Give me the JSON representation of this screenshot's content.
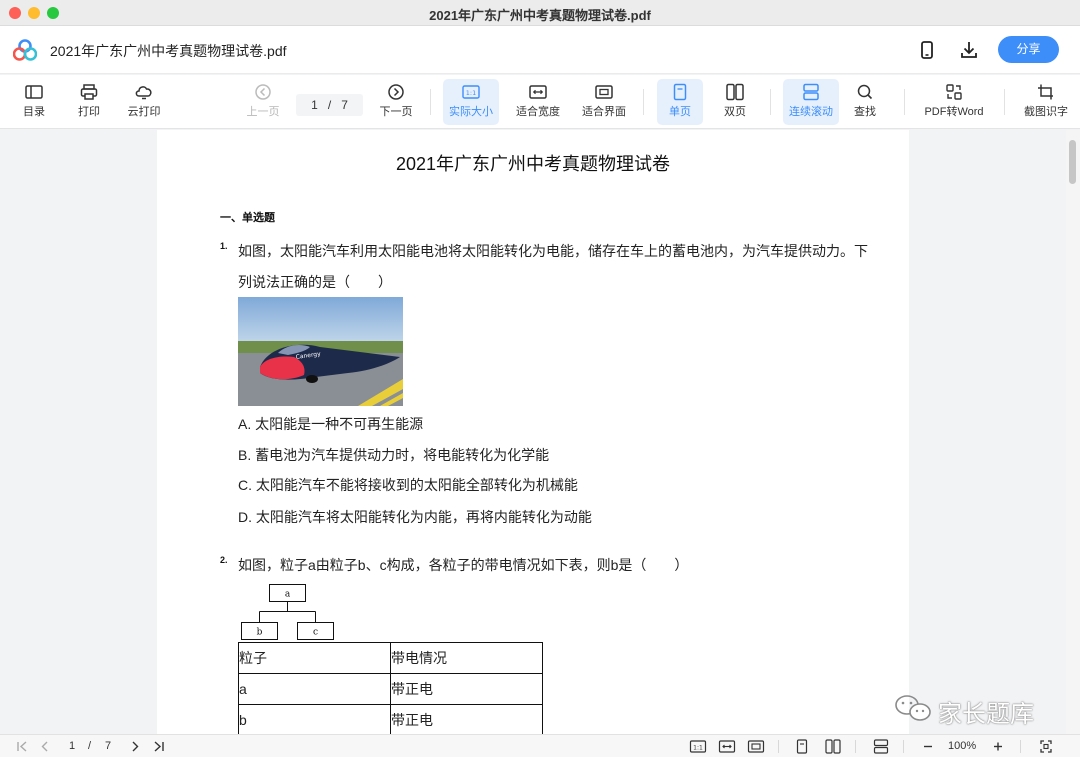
{
  "window": {
    "title": "2021年广东广州中考真题物理试卷.pdf"
  },
  "header": {
    "doc_title": "2021年广东广州中考真题物理试卷.pdf",
    "share_label": "分享",
    "icons": [
      "phone-icon",
      "download-icon"
    ]
  },
  "toolbar": {
    "toc_label": "目录",
    "print_label": "打印",
    "cloud_print_label": "云打印",
    "prev_label": "上一页",
    "current_page": "1",
    "page_sep": "/",
    "total_pages": "7",
    "next_label": "下一页",
    "actual_size_label": "实际大小",
    "actual_size_icon_text": "1:1",
    "fit_width_label": "适合宽度",
    "fit_page_label": "适合界面",
    "single_page_label": "单页",
    "double_page_label": "双页",
    "continuous_label": "连续滚动",
    "search_label": "查找",
    "pdf_to_word_label": "PDF转Word",
    "ocr_label": "截图识字",
    "accent_color": "#3d8ef8"
  },
  "document": {
    "title": "2021年广东广州中考真题物理试卷",
    "section": "一、单选题",
    "q1": {
      "number": "1.",
      "line1": "如图，太阳能汽车利用太阳能电池将太阳能转化为电能，储存在车上的蓄电池内，为汽车提供动力。下",
      "line2": "列说法正确的是（　　）",
      "image_caption": "Canergy",
      "options": [
        "A. 太阳能是一种不可再生能源",
        "B. 蓄电池为汽车提供动力时，将电能转化为化学能",
        "C. 太阳能汽车不能将接收到的太阳能全部转化为机械能",
        "D. 太阳能汽车将太阳能转化为内能，再将内能转化为动能"
      ]
    },
    "q2": {
      "number": "2.",
      "line1": "如图，粒子a由粒子b、c构成，各粒子的带电情况如下表，则b是（　　）",
      "tree": {
        "root": "a",
        "left": "b",
        "right": "c"
      },
      "table": {
        "headers": [
          "粒子",
          "带电情况"
        ],
        "rows": [
          [
            "a",
            "带正电"
          ],
          [
            "b",
            "带正电"
          ]
        ]
      }
    }
  },
  "watermark": {
    "text": "家长题库"
  },
  "statusbar": {
    "current_page": "1",
    "page_sep": "/",
    "total_pages": "7",
    "zoom": "100%",
    "actual_size_icon_text": "1:1"
  }
}
